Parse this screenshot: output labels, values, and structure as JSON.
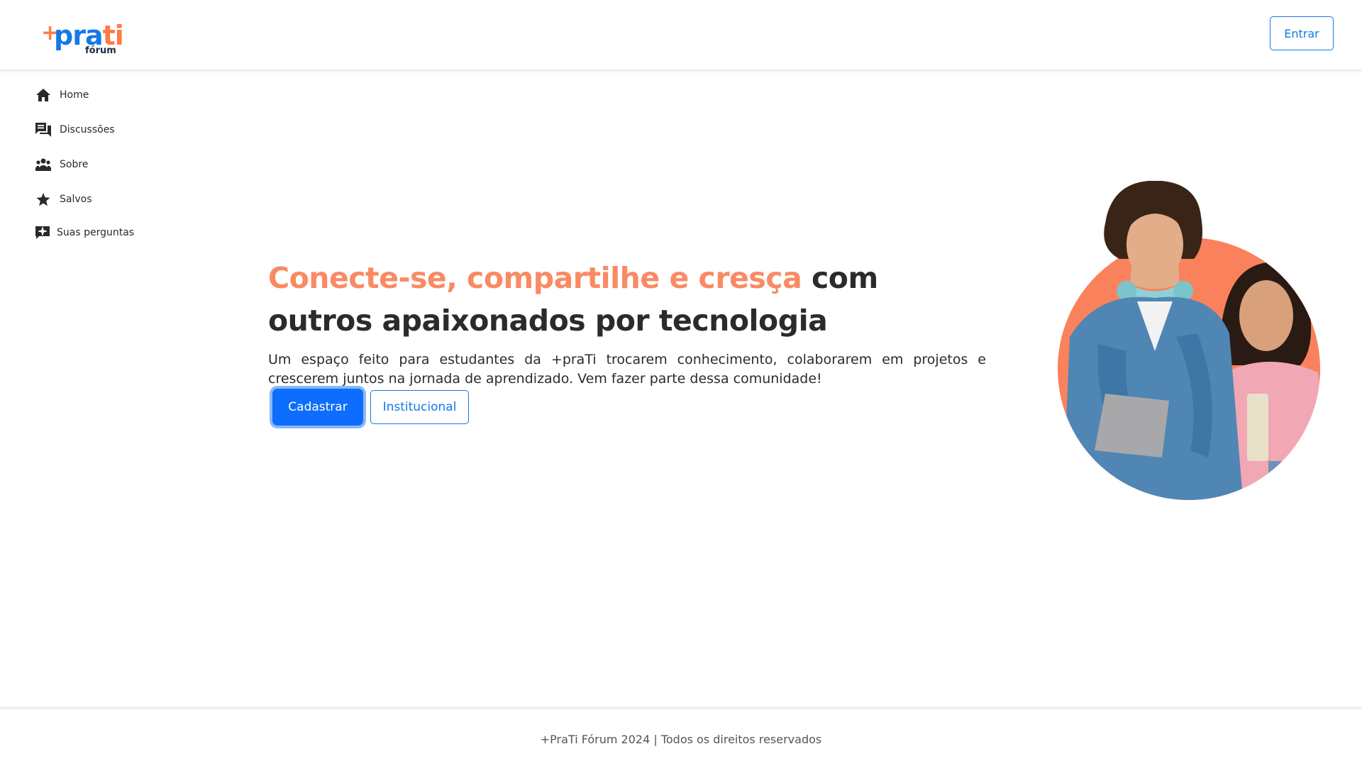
{
  "header": {
    "logo": {
      "plus": "+",
      "word_blue": "pra",
      "word_orange": "ti",
      "sub": "fórum"
    },
    "login_label": "Entrar"
  },
  "sidebar": {
    "items": [
      {
        "label": "Home",
        "icon": "home-icon"
      },
      {
        "label": "Discussões",
        "icon": "forum-icon"
      },
      {
        "label": "Sobre",
        "icon": "group-icon"
      },
      {
        "label": "Salvos",
        "icon": "star-icon"
      },
      {
        "label": "Suas perguntas",
        "icon": "question-icon"
      }
    ]
  },
  "hero": {
    "headline_accent": "Conecte-se, compartilhe e cresça",
    "headline_rest": " com outros apaixonados por tecnologia",
    "description": "Um espaço feito para estudantes da +praTi trocarem conhecimento, colaborarem em projetos e crescerem juntos na jornada de aprendizado. Vem fazer parte dessa comunidade!",
    "primary_cta": "Cadastrar",
    "secondary_cta": "Institucional"
  },
  "footer": {
    "text": "+PraTi Fórum 2024 | Todos os direitos reservados"
  },
  "colors": {
    "brand_blue": "#1479e8",
    "brand_orange": "#fa8a63",
    "button_blue": "#0d6efd"
  }
}
